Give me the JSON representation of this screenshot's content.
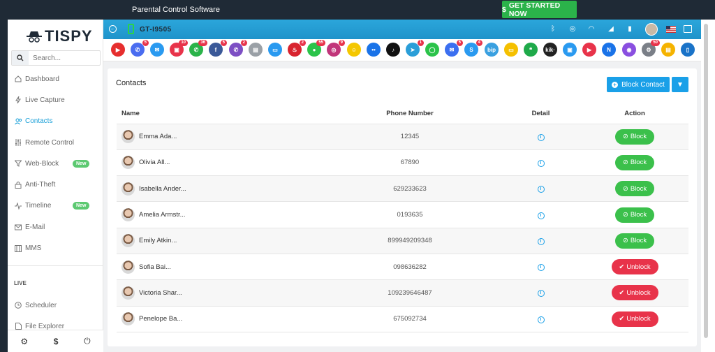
{
  "topbar": {
    "title": "Parental Control Software",
    "cta": "GET STARTED NOW"
  },
  "brand": {
    "name": "TISPY"
  },
  "search": {
    "placeholder": "Search..."
  },
  "nav": {
    "items": [
      {
        "label": "Dashboard",
        "icon": "home-icon"
      },
      {
        "label": "Live Capture",
        "icon": "bolt-icon"
      },
      {
        "label": "Contacts",
        "icon": "users-icon"
      },
      {
        "label": "Remote Control",
        "icon": "sliders-icon"
      },
      {
        "label": "Web-Block",
        "icon": "filter-icon",
        "badge": "New"
      },
      {
        "label": "Anti-Theft",
        "icon": "lock-icon"
      },
      {
        "label": "Timeline",
        "icon": "activity-icon",
        "badge": "New"
      },
      {
        "label": "E-Mail",
        "icon": "mail-icon"
      },
      {
        "label": "MMS",
        "icon": "film-icon"
      }
    ],
    "live_label": "LIVE",
    "live_items": [
      {
        "label": "Scheduler",
        "icon": "clock-icon"
      },
      {
        "label": "File Explorer",
        "icon": "file-icon"
      }
    ]
  },
  "device": {
    "name": "GT-I9505"
  },
  "apps": [
    {
      "name": "youtube",
      "color": "#e62e2e",
      "glyph": "▶"
    },
    {
      "name": "calls",
      "color": "#4a6cf0",
      "glyph": "✆",
      "badge": "5"
    },
    {
      "name": "mail",
      "color": "#2a9af0",
      "glyph": "✉"
    },
    {
      "name": "photos",
      "color": "#e8334a",
      "glyph": "▣",
      "badge": "10"
    },
    {
      "name": "whatsapp",
      "color": "#2bb34a",
      "glyph": "✆",
      "badge": "36"
    },
    {
      "name": "facebook",
      "color": "#3b5998",
      "glyph": "f",
      "badge": "5"
    },
    {
      "name": "viber",
      "color": "#7d4fc4",
      "glyph": "✆",
      "badge": "2"
    },
    {
      "name": "clipboard",
      "color": "#9aa0a6",
      "glyph": "▤"
    },
    {
      "name": "screen",
      "color": "#2a9af0",
      "glyph": "▭"
    },
    {
      "name": "tinder",
      "color": "#d8232e",
      "glyph": "♨",
      "badge": "2"
    },
    {
      "name": "wechat",
      "color": "#2bc34a",
      "glyph": "●",
      "badge": "55"
    },
    {
      "name": "instagram",
      "color": "#c1357a",
      "glyph": "◎",
      "badge": "9"
    },
    {
      "name": "snapchat",
      "color": "#f4c700",
      "glyph": "☺"
    },
    {
      "name": "flickr",
      "color": "#1a73e8",
      "glyph": "••"
    },
    {
      "name": "tiktok",
      "color": "#111111",
      "glyph": "♪"
    },
    {
      "name": "telegram",
      "color": "#2a9ed8",
      "glyph": "➤",
      "badge": "1"
    },
    {
      "name": "line",
      "color": "#2bc34a",
      "glyph": "◯"
    },
    {
      "name": "messenger",
      "color": "#3b6ff0",
      "glyph": "✉",
      "badge": "5"
    },
    {
      "name": "skype",
      "color": "#2a9af0",
      "glyph": "S",
      "badge": "4"
    },
    {
      "name": "bip",
      "color": "#3aa0e0",
      "glyph": "bip"
    },
    {
      "name": "talk",
      "color": "#f5c000",
      "glyph": "▭"
    },
    {
      "name": "hangouts",
      "color": "#1faa4a",
      "glyph": "❝"
    },
    {
      "name": "kik",
      "color": "#222222",
      "glyph": "kik·"
    },
    {
      "name": "imo",
      "color": "#2a9af0",
      "glyph": "▣"
    },
    {
      "name": "video",
      "color": "#e8334a",
      "glyph": "▶"
    },
    {
      "name": "nimbuzz",
      "color": "#1a73e8",
      "glyph": "N"
    },
    {
      "name": "bubble",
      "color": "#8a4fe0",
      "glyph": "◉"
    },
    {
      "name": "settings",
      "color": "#7a7f87",
      "glyph": "⚙",
      "badge": "50"
    },
    {
      "name": "notes",
      "color": "#f5b300",
      "glyph": "▤"
    },
    {
      "name": "device",
      "color": "#1a73c8",
      "glyph": "▯"
    }
  ],
  "card": {
    "title": "Contacts",
    "block_button": "Block Contact"
  },
  "table": {
    "headers": {
      "name": "Name",
      "phone": "Phone Number",
      "detail": "Detail",
      "action": "Action"
    },
    "rows": [
      {
        "name": "Emma Ada...",
        "phone": "12345",
        "action": "Block",
        "state": "block"
      },
      {
        "name": "Olivia All...",
        "phone": "67890",
        "action": "Block",
        "state": "block"
      },
      {
        "name": "Isabella Ander...",
        "phone": "629233623",
        "action": "Block",
        "state": "block"
      },
      {
        "name": "Amelia Armstr...",
        "phone": "0193635",
        "action": "Block",
        "state": "block"
      },
      {
        "name": "Emily Atkin...",
        "phone": "899949209348",
        "action": "Block",
        "state": "block"
      },
      {
        "name": "Sofia Bai...",
        "phone": "098636282",
        "action": "Unblock",
        "state": "unblock"
      },
      {
        "name": "Victoria Shar...",
        "phone": "109239646487",
        "action": "Unblock",
        "state": "unblock"
      },
      {
        "name": "Penelope Ba...",
        "phone": "675092734",
        "action": "Unblock",
        "state": "unblock"
      }
    ]
  }
}
